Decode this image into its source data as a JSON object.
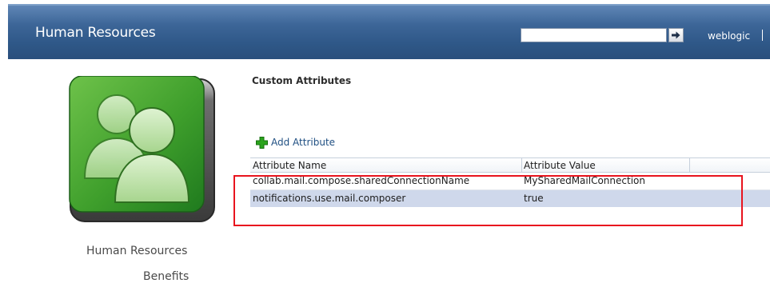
{
  "header": {
    "title": "Human Resources",
    "search_value": "",
    "user_name": "weblogic"
  },
  "sidebar": {
    "items": [
      {
        "label": "Human Resources"
      },
      {
        "label": "Benefits"
      }
    ]
  },
  "main": {
    "section_title": "Custom Attributes",
    "add_button_label": "Add Attribute",
    "table": {
      "columns": [
        "Attribute Name",
        "Attribute Value"
      ],
      "rows": [
        [
          "collab.mail.compose.sharedConnectionName",
          "MySharedMailConnection"
        ],
        [
          "notifications.use.mail.composer",
          "true"
        ]
      ]
    }
  },
  "colors": {
    "header_bg": "#3d6698",
    "selected_row": "#cfd8eb",
    "highlight_border": "#e8141e",
    "add_icon": "#2aa31c"
  },
  "icons": {
    "search_go": "arrow-right-icon",
    "add": "plus-icon",
    "avatar": "users-group-icon"
  }
}
